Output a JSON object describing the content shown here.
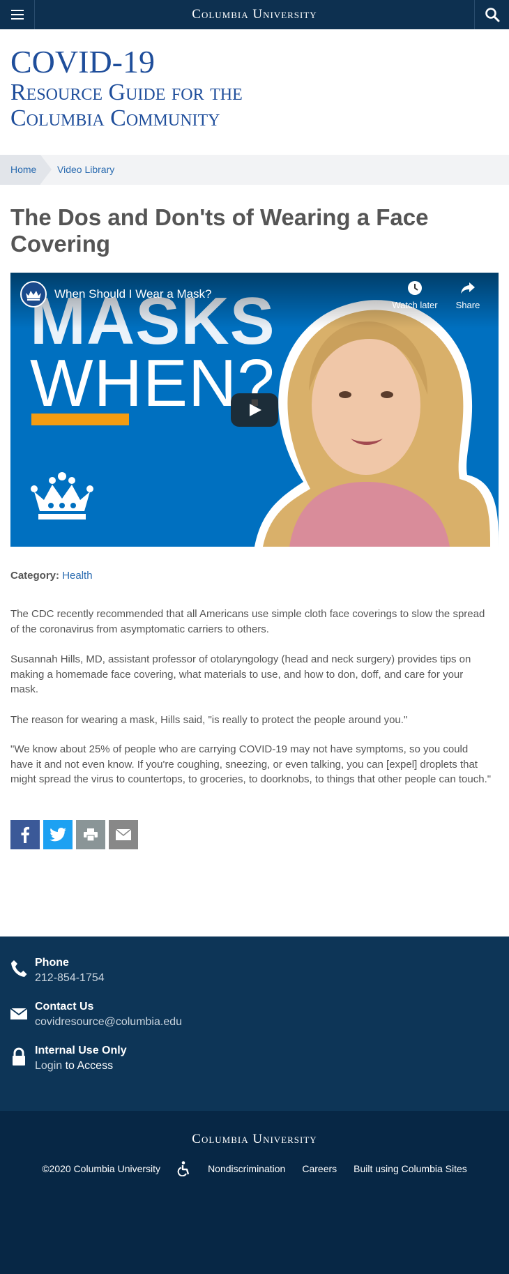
{
  "topbar": {
    "brand": "Columbia University"
  },
  "site": {
    "title_line1": "COVID-19",
    "title_line2": "Resource Guide for the",
    "title_line3": "Columbia Community"
  },
  "breadcrumb": {
    "home": "Home",
    "current": "Video Library"
  },
  "page": {
    "title": "The Dos and Don'ts of Wearing a Face Covering"
  },
  "video": {
    "title": "When Should I Wear a Mask?",
    "watch_later": "Watch later",
    "share": "Share",
    "thumbnail_line1": "MASKS",
    "thumbnail_line2": "WHEN?",
    "accent_color": "#f39c12",
    "background_color": "#0070c0"
  },
  "category": {
    "label": "Category:",
    "value": "Health"
  },
  "body": {
    "p1": "The CDC recently recommended that all Americans use simple cloth face coverings to slow the spread of the coronavirus from asymptomatic carriers to others.",
    "p2": "Susannah Hills, MD, assistant professor of otolaryngology (head and neck surgery) provides tips on making a homemade face covering, what materials to use, and how to don, doff, and care for your mask.",
    "p3": "The reason for wearing a mask, Hills said, \"is really to protect the people around you.\"",
    "p4": "\"We know about 25% of people who are carrying COVID-19 may not have symptoms, so you could have it and not even know. If you're coughing, sneezing, or even talking, you can [expel] droplets that might spread the virus to countertops, to groceries, to doorknobs, to things that other people can touch.\""
  },
  "share_icons": [
    "facebook-icon",
    "twitter-icon",
    "print-icon",
    "email-icon"
  ],
  "footer": {
    "phone_title": "Phone",
    "phone_value": "212-854-1754",
    "contact_title": "Contact Us",
    "contact_value": "covidresource@columbia.edu",
    "internal_title": "Internal Use Only",
    "login_link": "Login",
    "login_suffix": " to Access",
    "brand": "Columbia University",
    "copyright": "©2020 Columbia University",
    "nondiscrimination": "Nondiscrimination",
    "careers": "Careers",
    "built_using": "Built using Columbia Sites"
  },
  "colors": {
    "navy": "#0d3050",
    "link_blue": "#2a6bb0",
    "title_blue": "#1f4e9b",
    "footer_dark": "#072745"
  }
}
